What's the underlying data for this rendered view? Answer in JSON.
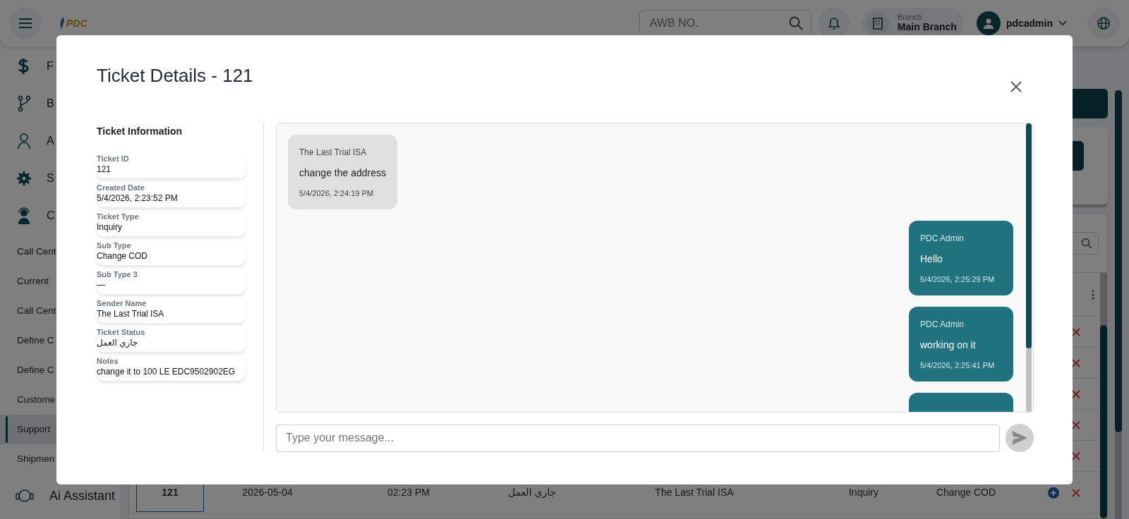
{
  "topbar": {
    "logo": "PDC",
    "search": {
      "placeholder": "AWB NO."
    },
    "branch": {
      "label": "Branch",
      "value": "Main Branch"
    },
    "user": {
      "name": "pdcadmin"
    }
  },
  "sidebar": {
    "groups": [
      {
        "label": "F"
      },
      {
        "label": "B"
      },
      {
        "label": "A"
      },
      {
        "label": "S"
      },
      {
        "label": "C"
      }
    ],
    "items": [
      {
        "label": "Call Cent",
        "selected": false
      },
      {
        "label": "Current",
        "selected": false
      },
      {
        "label": "Call Cent",
        "selected": false
      },
      {
        "label": "Define C",
        "selected": false
      },
      {
        "label": "Define C",
        "selected": false
      },
      {
        "label": "Custome",
        "selected": false
      },
      {
        "label": "Support",
        "selected": true
      },
      {
        "label": "Shipmen",
        "selected": false
      }
    ],
    "assistant": "Ai Assistant"
  },
  "table": {
    "rows": [
      {
        "cells": []
      },
      {
        "cells": []
      },
      {
        "cells": []
      },
      {
        "cells": []
      },
      {
        "cells": []
      },
      {
        "cells": [
          "121",
          "2026-05-04",
          "02:23 PM",
          "جاري العمل",
          "The Last Trial ISA",
          "Inquiry",
          "Change COD"
        ]
      }
    ]
  },
  "modal": {
    "title": "Ticket Details - 121",
    "info_heading": "Ticket Information",
    "fields": [
      {
        "label": "Ticket ID",
        "value": "121"
      },
      {
        "label": "Created Date",
        "value": "5/4/2026, 2:23:52 PM"
      },
      {
        "label": "Ticket Type",
        "value": "Inquiry"
      },
      {
        "label": "Sub Type",
        "value": "Change COD"
      },
      {
        "label": "Sub Type 3",
        "value": "—"
      },
      {
        "label": "Sender Name",
        "value": "The Last Trial ISA"
      },
      {
        "label": "Ticket Status",
        "value": "جاري العمل"
      },
      {
        "label": "Notes",
        "value": "change it to 100 LE EDC9502902EG"
      }
    ],
    "messages": [
      {
        "kind": "incoming",
        "sender": "The Last Trial ISA",
        "text": "change the address",
        "time": "5/4/2026, 2:24:19 PM"
      },
      {
        "kind": "outgoing",
        "sender": "PDC Admin",
        "text": "Hello",
        "time": "5/4/2026, 2:25:29 PM"
      },
      {
        "kind": "outgoing",
        "sender": "PDC Admin",
        "text": "working on it",
        "time": "5/4/2026, 2:25:41 PM"
      },
      {
        "kind": "outgoing"
      }
    ],
    "composer": {
      "placeholder": "Type your message..."
    }
  }
}
